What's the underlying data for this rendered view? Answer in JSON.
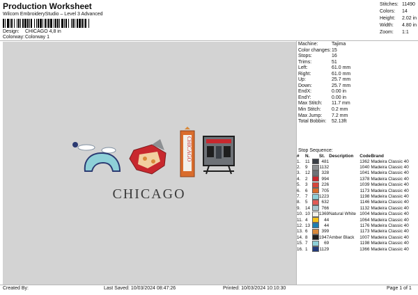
{
  "header": {
    "title": "Production Worksheet",
    "software": "Wilcom EmbroideryStudio – Level 3 Advanced",
    "design_label": "Design:",
    "design_value": "CHICAGO 4,8 in",
    "colorway_label": "Colorway:",
    "colorway_value": "Colorway 1"
  },
  "stats": [
    {
      "k": "Stitches:",
      "v": "11490"
    },
    {
      "k": "Colors:",
      "v": "14"
    },
    {
      "k": "Height:",
      "v": "2.02 in"
    },
    {
      "k": "Width:",
      "v": "4.80 in"
    },
    {
      "k": "Zoom:",
      "v": "1:1"
    }
  ],
  "preview": {
    "text": "CHICAGO",
    "sign_text": "CHICAGO"
  },
  "properties": [
    {
      "k": "Machine:",
      "v": "Tajima"
    },
    {
      "k": "Color changes:",
      "v": "15"
    },
    {
      "k": "Stops:",
      "v": "16"
    },
    {
      "k": "Trims:",
      "v": "51"
    },
    {
      "k": "Left:",
      "v": "61.0 mm"
    },
    {
      "k": "Right:",
      "v": "61.0 mm"
    },
    {
      "k": "Up:",
      "v": "25.7 mm"
    },
    {
      "k": "Down:",
      "v": "25.7 mm"
    },
    {
      "k": "EndX:",
      "v": "0.00 in"
    },
    {
      "k": "EndY:",
      "v": "0.00 in"
    },
    {
      "k": "Max Stitch:",
      "v": "11.7 mm"
    },
    {
      "k": "Min Stitch:",
      "v": "0.2 mm"
    },
    {
      "k": "Max Jump:",
      "v": "7.2 mm"
    },
    {
      "k": "Total Bobbin:",
      "v": "52.13ft"
    }
  ],
  "sequence": {
    "title": "Stop Sequence:",
    "headers": [
      "#",
      "N.",
      "St.",
      "Description",
      "Code",
      "Brand"
    ],
    "rows": [
      {
        "n": "1.",
        "nn": "11",
        "color": "#3a3f46",
        "st": "481",
        "desc": "",
        "code": "1362",
        "brand": "Madeira Classic 40"
      },
      {
        "n": "2.",
        "nn": "9",
        "color": "#8c8f92",
        "st": "1132",
        "desc": "",
        "code": "1040",
        "brand": "Madeira Classic 40"
      },
      {
        "n": "3.",
        "nn": "12",
        "color": "#6e7277",
        "st": "328",
        "desc": "",
        "code": "1041",
        "brand": "Madeira Classic 40"
      },
      {
        "n": "4.",
        "nn": "2",
        "color": "#c8282e",
        "st": "994",
        "desc": "",
        "code": "1378",
        "brand": "Madeira Classic 40"
      },
      {
        "n": "5.",
        "nn": "3",
        "color": "#d6453a",
        "st": "226",
        "desc": "",
        "code": "1039",
        "brand": "Madeira Classic 40"
      },
      {
        "n": "6.",
        "nn": "6",
        "color": "#d96c2c",
        "st": "705",
        "desc": "",
        "code": "1173",
        "brand": "Madeira Classic 40"
      },
      {
        "n": "7.",
        "nn": "7",
        "color": "#8ed0d8",
        "st": "1223",
        "desc": "",
        "code": "1198",
        "brand": "Madeira Classic 40"
      },
      {
        "n": "8.",
        "nn": "5",
        "color": "#e25b57",
        "st": "632",
        "desc": "",
        "code": "1146",
        "brand": "Madeira Classic 40"
      },
      {
        "n": "9.",
        "nn": "14",
        "color": "#a9c6cf",
        "st": "766",
        "desc": "",
        "code": "1132",
        "brand": "Madeira Classic 40"
      },
      {
        "n": "10.",
        "nn": "10",
        "color": "#f2f0ea",
        "st": "1369",
        "desc": "Natural White",
        "code": "1004",
        "brand": "Madeira Classic 40"
      },
      {
        "n": "11.",
        "nn": "4",
        "color": "#f4c21a",
        "st": "44",
        "desc": "",
        "code": "1064",
        "brand": "Madeira Classic 40"
      },
      {
        "n": "12.",
        "nn": "13",
        "color": "#1d7fb0",
        "st": "44",
        "desc": "",
        "code": "1176",
        "brand": "Madeira Classic 40"
      },
      {
        "n": "13.",
        "nn": "6",
        "color": "#d9893a",
        "st": "399",
        "desc": "",
        "code": "1173",
        "brand": "Madeira Classic 40"
      },
      {
        "n": "14.",
        "nn": "8",
        "color": "#1e1e1e",
        "st": "1947",
        "desc": "Amber Black",
        "code": "1007",
        "brand": "Madeira Classic 40"
      },
      {
        "n": "15.",
        "nn": "7",
        "color": "#8ed0d8",
        "st": "69",
        "desc": "",
        "code": "1198",
        "brand": "Madeira Classic 40"
      },
      {
        "n": "16.",
        "nn": "1",
        "color": "#233a7a",
        "st": "1129",
        "desc": "",
        "code": "1366",
        "brand": "Madeira Classic 40"
      }
    ]
  },
  "footer": {
    "created": "Created By:",
    "saved": "Last Saved: 10/03/2024 08:47:26",
    "printed": "Printed: 10/03/2024 10:10:30",
    "page": "Page 1 of 1"
  }
}
